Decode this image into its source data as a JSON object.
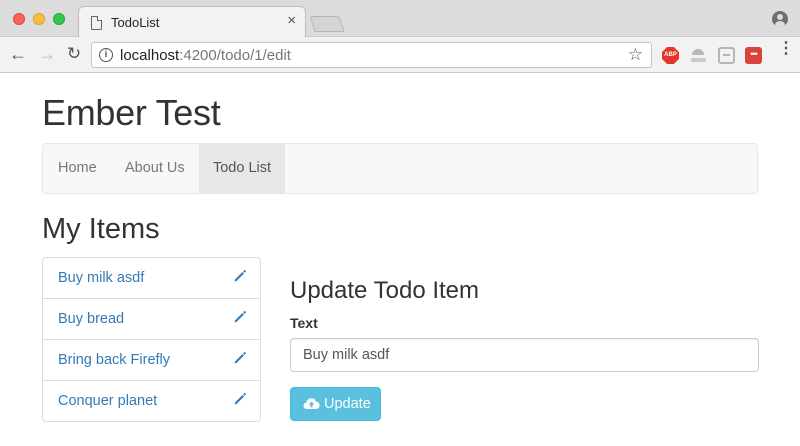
{
  "browser": {
    "tab_title": "TodoList",
    "tab_close": "×",
    "url_host": "localhost",
    "url_path": ":4200/todo/1/edit",
    "extension_abp": "ABP",
    "extension_last": "•••"
  },
  "page": {
    "site_title": "Ember Test",
    "nav": [
      {
        "label": "Home",
        "active": false
      },
      {
        "label": "About Us",
        "active": false
      },
      {
        "label": "Todo List",
        "active": true
      }
    ],
    "section_title": "My Items",
    "items": [
      {
        "label": "Buy milk asdf"
      },
      {
        "label": "Buy bread"
      },
      {
        "label": "Bring back Firefly"
      },
      {
        "label": "Conquer planet"
      }
    ],
    "form": {
      "title": "Update Todo Item",
      "text_label": "Text",
      "text_value": "Buy milk asdf",
      "submit_label": "Update"
    }
  },
  "colors": {
    "link": "#337ab7",
    "button_info": "#5bc0de",
    "navbar_bg": "#f8f8f8",
    "nav_active_bg": "#e7e7e7"
  }
}
